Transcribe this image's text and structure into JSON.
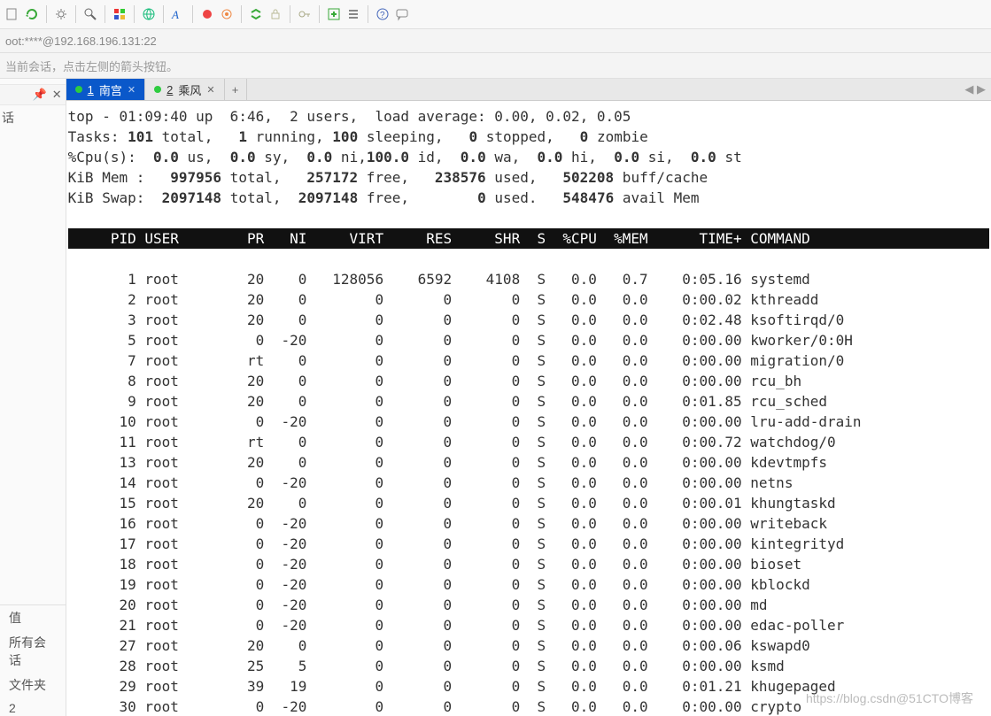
{
  "address_bar": "oot:****@192.168.196.131:22",
  "subtext": "当前会话，点击左侧的箭头按钮。",
  "tabs": [
    {
      "index": "1",
      "label": "南宫",
      "active": true
    },
    {
      "index": "2",
      "label": "乘风",
      "active": false
    }
  ],
  "sidebar_top": {
    "label1": "话"
  },
  "sidebar_bottom": {
    "header": "",
    "items": [
      "值",
      "所有会话",
      "文件夹",
      "2"
    ]
  },
  "top_summary": {
    "line1_prefix": "top - 01:09:40 up  6:46,  2 users,  load average: 0.00, 0.02, 0.05",
    "tasks_lbl": "Tasks:",
    "tasks_total": "101",
    "tasks_total_sfx": " total,",
    "tasks_run": "1",
    "tasks_run_sfx": " running,",
    "tasks_sleep": "100",
    "tasks_sleep_sfx": " sleeping,",
    "tasks_stop": "0",
    "tasks_stop_sfx": " stopped,",
    "tasks_zmb": "0",
    "tasks_zmb_sfx": " zombie",
    "cpu_lbl": "%Cpu(s):",
    "cpu_us": "0.0",
    "cpu_sy": "0.0",
    "cpu_ni": "0.0",
    "cpu_id": "100.0",
    "cpu_wa": "0.0",
    "cpu_hi": "0.0",
    "cpu_si": "0.0",
    "cpu_st": "0.0",
    "mem_lbl": "KiB Mem :",
    "mem_total": "997956",
    "mem_free": "257172",
    "mem_used": "238576",
    "mem_buff": "502208",
    "swap_lbl": "KiB Swap:",
    "swap_total": "2097148",
    "swap_free": "2097148",
    "swap_used": "0",
    "swap_avail": "548476"
  },
  "columns": [
    "PID",
    "USER",
    "PR",
    "NI",
    "VIRT",
    "RES",
    "SHR",
    "S",
    "%CPU",
    "%MEM",
    "TIME+",
    "COMMAND"
  ],
  "processes": [
    {
      "pid": "1",
      "user": "root",
      "pr": "20",
      "ni": "0",
      "virt": "128056",
      "res": "6592",
      "shr": "4108",
      "s": "S",
      "cpu": "0.0",
      "mem": "0.7",
      "time": "0:05.16",
      "cmd": "systemd"
    },
    {
      "pid": "2",
      "user": "root",
      "pr": "20",
      "ni": "0",
      "virt": "0",
      "res": "0",
      "shr": "0",
      "s": "S",
      "cpu": "0.0",
      "mem": "0.0",
      "time": "0:00.02",
      "cmd": "kthreadd"
    },
    {
      "pid": "3",
      "user": "root",
      "pr": "20",
      "ni": "0",
      "virt": "0",
      "res": "0",
      "shr": "0",
      "s": "S",
      "cpu": "0.0",
      "mem": "0.0",
      "time": "0:02.48",
      "cmd": "ksoftirqd/0"
    },
    {
      "pid": "5",
      "user": "root",
      "pr": "0",
      "ni": "-20",
      "virt": "0",
      "res": "0",
      "shr": "0",
      "s": "S",
      "cpu": "0.0",
      "mem": "0.0",
      "time": "0:00.00",
      "cmd": "kworker/0:0H"
    },
    {
      "pid": "7",
      "user": "root",
      "pr": "rt",
      "ni": "0",
      "virt": "0",
      "res": "0",
      "shr": "0",
      "s": "S",
      "cpu": "0.0",
      "mem": "0.0",
      "time": "0:00.00",
      "cmd": "migration/0"
    },
    {
      "pid": "8",
      "user": "root",
      "pr": "20",
      "ni": "0",
      "virt": "0",
      "res": "0",
      "shr": "0",
      "s": "S",
      "cpu": "0.0",
      "mem": "0.0",
      "time": "0:00.00",
      "cmd": "rcu_bh"
    },
    {
      "pid": "9",
      "user": "root",
      "pr": "20",
      "ni": "0",
      "virt": "0",
      "res": "0",
      "shr": "0",
      "s": "S",
      "cpu": "0.0",
      "mem": "0.0",
      "time": "0:01.85",
      "cmd": "rcu_sched"
    },
    {
      "pid": "10",
      "user": "root",
      "pr": "0",
      "ni": "-20",
      "virt": "0",
      "res": "0",
      "shr": "0",
      "s": "S",
      "cpu": "0.0",
      "mem": "0.0",
      "time": "0:00.00",
      "cmd": "lru-add-drain"
    },
    {
      "pid": "11",
      "user": "root",
      "pr": "rt",
      "ni": "0",
      "virt": "0",
      "res": "0",
      "shr": "0",
      "s": "S",
      "cpu": "0.0",
      "mem": "0.0",
      "time": "0:00.72",
      "cmd": "watchdog/0"
    },
    {
      "pid": "13",
      "user": "root",
      "pr": "20",
      "ni": "0",
      "virt": "0",
      "res": "0",
      "shr": "0",
      "s": "S",
      "cpu": "0.0",
      "mem": "0.0",
      "time": "0:00.00",
      "cmd": "kdevtmpfs"
    },
    {
      "pid": "14",
      "user": "root",
      "pr": "0",
      "ni": "-20",
      "virt": "0",
      "res": "0",
      "shr": "0",
      "s": "S",
      "cpu": "0.0",
      "mem": "0.0",
      "time": "0:00.00",
      "cmd": "netns"
    },
    {
      "pid": "15",
      "user": "root",
      "pr": "20",
      "ni": "0",
      "virt": "0",
      "res": "0",
      "shr": "0",
      "s": "S",
      "cpu": "0.0",
      "mem": "0.0",
      "time": "0:00.01",
      "cmd": "khungtaskd"
    },
    {
      "pid": "16",
      "user": "root",
      "pr": "0",
      "ni": "-20",
      "virt": "0",
      "res": "0",
      "shr": "0",
      "s": "S",
      "cpu": "0.0",
      "mem": "0.0",
      "time": "0:00.00",
      "cmd": "writeback"
    },
    {
      "pid": "17",
      "user": "root",
      "pr": "0",
      "ni": "-20",
      "virt": "0",
      "res": "0",
      "shr": "0",
      "s": "S",
      "cpu": "0.0",
      "mem": "0.0",
      "time": "0:00.00",
      "cmd": "kintegrityd"
    },
    {
      "pid": "18",
      "user": "root",
      "pr": "0",
      "ni": "-20",
      "virt": "0",
      "res": "0",
      "shr": "0",
      "s": "S",
      "cpu": "0.0",
      "mem": "0.0",
      "time": "0:00.00",
      "cmd": "bioset"
    },
    {
      "pid": "19",
      "user": "root",
      "pr": "0",
      "ni": "-20",
      "virt": "0",
      "res": "0",
      "shr": "0",
      "s": "S",
      "cpu": "0.0",
      "mem": "0.0",
      "time": "0:00.00",
      "cmd": "kblockd"
    },
    {
      "pid": "20",
      "user": "root",
      "pr": "0",
      "ni": "-20",
      "virt": "0",
      "res": "0",
      "shr": "0",
      "s": "S",
      "cpu": "0.0",
      "mem": "0.0",
      "time": "0:00.00",
      "cmd": "md"
    },
    {
      "pid": "21",
      "user": "root",
      "pr": "0",
      "ni": "-20",
      "virt": "0",
      "res": "0",
      "shr": "0",
      "s": "S",
      "cpu": "0.0",
      "mem": "0.0",
      "time": "0:00.00",
      "cmd": "edac-poller"
    },
    {
      "pid": "27",
      "user": "root",
      "pr": "20",
      "ni": "0",
      "virt": "0",
      "res": "0",
      "shr": "0",
      "s": "S",
      "cpu": "0.0",
      "mem": "0.0",
      "time": "0:00.06",
      "cmd": "kswapd0"
    },
    {
      "pid": "28",
      "user": "root",
      "pr": "25",
      "ni": "5",
      "virt": "0",
      "res": "0",
      "shr": "0",
      "s": "S",
      "cpu": "0.0",
      "mem": "0.0",
      "time": "0:00.00",
      "cmd": "ksmd"
    },
    {
      "pid": "29",
      "user": "root",
      "pr": "39",
      "ni": "19",
      "virt": "0",
      "res": "0",
      "shr": "0",
      "s": "S",
      "cpu": "0.0",
      "mem": "0.0",
      "time": "0:01.21",
      "cmd": "khugepaged"
    },
    {
      "pid": "30",
      "user": "root",
      "pr": "0",
      "ni": "-20",
      "virt": "0",
      "res": "0",
      "shr": "0",
      "s": "S",
      "cpu": "0.0",
      "mem": "0.0",
      "time": "0:00.00",
      "cmd": "crypto"
    }
  ],
  "watermark": "https://blog.csdn@51CTO博客"
}
